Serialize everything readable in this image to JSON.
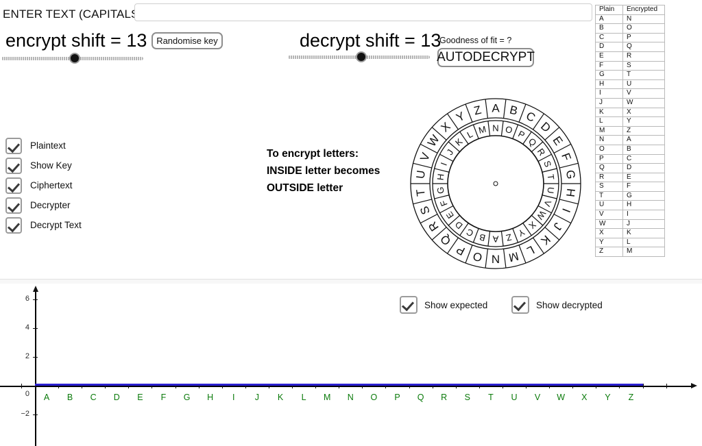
{
  "entry": {
    "label": "ENTER TEXT (CAPITALS)",
    "value": "",
    "placeholder": ""
  },
  "encrypt": {
    "title": "encrypt shift = 13",
    "shift": 13,
    "slider_min": 0,
    "slider_max": 25,
    "randomise_label": "Randomise key"
  },
  "decrypt": {
    "title": "decrypt shift = 13",
    "shift": 13,
    "slider_min": 0,
    "slider_max": 25,
    "goodness_label": "Goodness of fit = ?",
    "autodecrypt_label": "AUTODECRYPT"
  },
  "options": [
    {
      "label": "Plaintext",
      "checked": true
    },
    {
      "label": "Show Key",
      "checked": true
    },
    {
      "label": "Ciphertext",
      "checked": true
    },
    {
      "label": "Decrypter",
      "checked": true
    },
    {
      "label": "Decrypt Text",
      "checked": true
    }
  ],
  "instructions": {
    "line1": "To encrypt letters:",
    "line2": "INSIDE letter becomes",
    "line3": "OUTSIDE letter"
  },
  "wheel": {
    "outer_ring": [
      "A",
      "B",
      "C",
      "D",
      "E",
      "F",
      "G",
      "H",
      "I",
      "J",
      "K",
      "L",
      "M",
      "N",
      "O",
      "P",
      "Q",
      "R",
      "S",
      "T",
      "U",
      "V",
      "W",
      "X",
      "Y",
      "Z"
    ],
    "inner_ring": [
      "N",
      "O",
      "P",
      "Q",
      "R",
      "S",
      "T",
      "U",
      "V",
      "W",
      "X",
      "Y",
      "Z",
      "A",
      "B",
      "C",
      "D",
      "E",
      "F",
      "G",
      "H",
      "I",
      "J",
      "K",
      "L",
      "M"
    ],
    "shift": 13
  },
  "key_table": {
    "headers": [
      "Plain",
      "Encrypted"
    ],
    "rows": [
      [
        "A",
        "N"
      ],
      [
        "B",
        "O"
      ],
      [
        "C",
        "P"
      ],
      [
        "D",
        "Q"
      ],
      [
        "E",
        "R"
      ],
      [
        "F",
        "S"
      ],
      [
        "G",
        "T"
      ],
      [
        "H",
        "U"
      ],
      [
        "I",
        "V"
      ],
      [
        "J",
        "W"
      ],
      [
        "K",
        "X"
      ],
      [
        "L",
        "Y"
      ],
      [
        "M",
        "Z"
      ],
      [
        "N",
        "A"
      ],
      [
        "O",
        "B"
      ],
      [
        "P",
        "C"
      ],
      [
        "Q",
        "D"
      ],
      [
        "R",
        "E"
      ],
      [
        "S",
        "F"
      ],
      [
        "T",
        "G"
      ],
      [
        "U",
        "H"
      ],
      [
        "V",
        "I"
      ],
      [
        "W",
        "J"
      ],
      [
        "X",
        "K"
      ],
      [
        "Y",
        "L"
      ],
      [
        "Z",
        "M"
      ]
    ]
  },
  "graph_legend": [
    {
      "label": "Show expected",
      "checked": true
    },
    {
      "label": "Show decrypted",
      "checked": true
    }
  ],
  "chart_data": {
    "type": "bar",
    "title": "",
    "xlabel": "",
    "ylabel": "",
    "categories": [
      "A",
      "B",
      "C",
      "D",
      "E",
      "F",
      "G",
      "H",
      "I",
      "J",
      "K",
      "L",
      "M",
      "N",
      "O",
      "P",
      "Q",
      "R",
      "S",
      "T",
      "U",
      "V",
      "W",
      "X",
      "Y",
      "Z"
    ],
    "series": [
      {
        "name": "decrypted",
        "color": "#2a1fd0",
        "values": [
          0,
          0,
          0,
          0,
          0,
          0,
          0,
          0,
          0,
          0,
          0,
          0,
          0,
          0,
          0,
          0,
          0,
          0,
          0,
          0,
          0,
          0,
          0,
          0,
          0,
          0
        ]
      }
    ],
    "ylim": [
      -3,
      7
    ],
    "ytick_labels": [
      "6",
      "4",
      "2",
      "0",
      "−2"
    ],
    "ytick_values": [
      6,
      4,
      2,
      0,
      -2
    ],
    "grid": false,
    "legend_position": "top"
  },
  "colors": {
    "series_blue": "#2a1fd0",
    "category_green": "#0a7a0a",
    "axis_black": "#111111",
    "border_grey": "#9b9b9b"
  }
}
